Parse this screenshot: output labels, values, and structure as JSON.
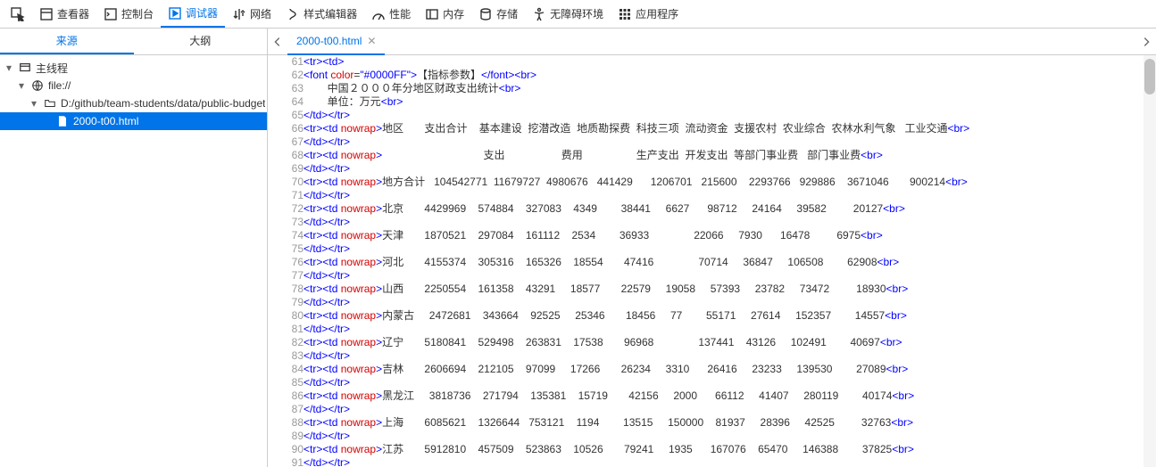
{
  "toolbar": {
    "items": [
      {
        "icon": "picker",
        "label": ""
      },
      {
        "icon": "inspector",
        "label": "查看器"
      },
      {
        "icon": "console",
        "label": "控制台"
      },
      {
        "icon": "debugger",
        "label": "调试器",
        "active": true
      },
      {
        "icon": "network",
        "label": "网络"
      },
      {
        "icon": "style",
        "label": "样式编辑器"
      },
      {
        "icon": "perf",
        "label": "性能"
      },
      {
        "icon": "memory",
        "label": "内存"
      },
      {
        "icon": "storage",
        "label": "存储"
      },
      {
        "icon": "a11y",
        "label": "无障碍环境"
      },
      {
        "icon": "apps",
        "label": "应用程序"
      }
    ]
  },
  "sidebar": {
    "tabs": [
      "来源",
      "大纲"
    ],
    "thread_label": "主线程",
    "file_label": "file://",
    "folder": "D:/github/team-students/data/public-budget",
    "selected_file": "2000-t00.html"
  },
  "editor": {
    "filename": "2000-t00.html"
  },
  "code": {
    "lines": [
      {
        "n": 61,
        "html": "<span class='tag'>&lt;tr&gt;&lt;td&gt;</span>"
      },
      {
        "n": 62,
        "html": "<span class='tag'>&lt;font</span> <span class='attr'>color</span>=<span class='str'>\"#0000FF\"</span><span class='tag'>&gt;</span>【指标参数】<span class='tag'>&lt;/font&gt;&lt;br&gt;</span>"
      },
      {
        "n": 63,
        "html": "        中国２０００年分地区财政支出统计<span class='tag'>&lt;br&gt;</span>"
      },
      {
        "n": 64,
        "html": "        单位：万元<span class='tag'>&lt;br&gt;</span>"
      },
      {
        "n": 65,
        "html": "<span class='tag'>&lt;/td&gt;&lt;/tr&gt;</span>"
      },
      {
        "n": 66,
        "html": "<span class='tag'>&lt;tr&gt;&lt;td</span> <span class='attr'>nowrap</span><span class='tag'>&gt;</span>地区       支出合计    基本建设  挖潜改造  地质勘探费  科技三项  流动资金  支援农村  农业综合  农林水利气象   工业交通<span class='tag'>&lt;br&gt;</span>"
      },
      {
        "n": 67,
        "html": "<span class='tag'>&lt;/td&gt;&lt;/tr&gt;</span>"
      },
      {
        "n": 68,
        "html": "<span class='tag'>&lt;tr&gt;&lt;td</span> <span class='attr'>nowrap</span><span class='tag'>&gt;</span>                                  支出                   费用                  生产支出  开发支出  等部门事业费   部门事业费<span class='tag'>&lt;br&gt;</span>"
      },
      {
        "n": 69,
        "html": "<span class='tag'>&lt;/td&gt;&lt;/tr&gt;</span>"
      },
      {
        "n": 70,
        "html": "<span class='tag'>&lt;tr&gt;&lt;td</span> <span class='attr'>nowrap</span><span class='tag'>&gt;</span>地方合计   104542771  11679727  4980676   441429      1206701   215600    2293766   929886    3671046       900214<span class='tag'>&lt;br&gt;</span>"
      },
      {
        "n": 71,
        "html": "<span class='tag'>&lt;/td&gt;&lt;/tr&gt;</span>"
      },
      {
        "n": 72,
        "html": "<span class='tag'>&lt;tr&gt;&lt;td</span> <span class='attr'>nowrap</span><span class='tag'>&gt;</span>北京       4429969    574884    327083    4349        38441     6627      98712     24164     39582         20127<span class='tag'>&lt;br&gt;</span>"
      },
      {
        "n": 73,
        "html": "<span class='tag'>&lt;/td&gt;&lt;/tr&gt;</span>"
      },
      {
        "n": 74,
        "html": "<span class='tag'>&lt;tr&gt;&lt;td</span> <span class='attr'>nowrap</span><span class='tag'>&gt;</span>天津       1870521    297084    161112    2534        36933               22066     7930      16478         6975<span class='tag'>&lt;br&gt;</span>"
      },
      {
        "n": 75,
        "html": "<span class='tag'>&lt;/td&gt;&lt;/tr&gt;</span>"
      },
      {
        "n": 76,
        "html": "<span class='tag'>&lt;tr&gt;&lt;td</span> <span class='attr'>nowrap</span><span class='tag'>&gt;</span>河北       4155374    305316    165326    18554       47416               70714     36847     106508        62908<span class='tag'>&lt;br&gt;</span>"
      },
      {
        "n": 77,
        "html": "<span class='tag'>&lt;/td&gt;&lt;/tr&gt;</span>"
      },
      {
        "n": 78,
        "html": "<span class='tag'>&lt;tr&gt;&lt;td</span> <span class='attr'>nowrap</span><span class='tag'>&gt;</span>山西       2250554    161358    43291     18577       22579     19058     57393     23782     73472         18930<span class='tag'>&lt;br&gt;</span>"
      },
      {
        "n": 79,
        "html": "<span class='tag'>&lt;/td&gt;&lt;/tr&gt;</span>"
      },
      {
        "n": 80,
        "html": "<span class='tag'>&lt;tr&gt;&lt;td</span> <span class='attr'>nowrap</span><span class='tag'>&gt;</span>内蒙古     2472681    343664    92525     25346       18456     77        55171     27614     152357        14557<span class='tag'>&lt;br&gt;</span>"
      },
      {
        "n": 81,
        "html": "<span class='tag'>&lt;/td&gt;&lt;/tr&gt;</span>"
      },
      {
        "n": 82,
        "html": "<span class='tag'>&lt;tr&gt;&lt;td</span> <span class='attr'>nowrap</span><span class='tag'>&gt;</span>辽宁       5180841    529498    263831    17538       96968               137441    43126     102491        40697<span class='tag'>&lt;br&gt;</span>"
      },
      {
        "n": 83,
        "html": "<span class='tag'>&lt;/td&gt;&lt;/tr&gt;</span>"
      },
      {
        "n": 84,
        "html": "<span class='tag'>&lt;tr&gt;&lt;td</span> <span class='attr'>nowrap</span><span class='tag'>&gt;</span>吉林       2606694    212105    97099     17266       26234     3310      26416     23233     139530        27089<span class='tag'>&lt;br&gt;</span>"
      },
      {
        "n": 85,
        "html": "<span class='tag'>&lt;/td&gt;&lt;/tr&gt;</span>"
      },
      {
        "n": 86,
        "html": "<span class='tag'>&lt;tr&gt;&lt;td</span> <span class='attr'>nowrap</span><span class='tag'>&gt;</span>黑龙江     3818736    271794    135381    15719       42156     2000      66112     41407     280119        40174<span class='tag'>&lt;br&gt;</span>"
      },
      {
        "n": 87,
        "html": "<span class='tag'>&lt;/td&gt;&lt;/tr&gt;</span>"
      },
      {
        "n": 88,
        "html": "<span class='tag'>&lt;tr&gt;&lt;td</span> <span class='attr'>nowrap</span><span class='tag'>&gt;</span>上海       6085621    1326644   753121    1194        13515     150000    81937     28396     42525         32763<span class='tag'>&lt;br&gt;</span>"
      },
      {
        "n": 89,
        "html": "<span class='tag'>&lt;/td&gt;&lt;/tr&gt;</span>"
      },
      {
        "n": 90,
        "html": "<span class='tag'>&lt;tr&gt;&lt;td</span> <span class='attr'>nowrap</span><span class='tag'>&gt;</span>江苏       5912810    457509    523863    10526       79241     1935      167076    65470     146388        37825<span class='tag'>&lt;br&gt;</span>"
      },
      {
        "n": 91,
        "html": "<span class='tag'>&lt;/td&gt;&lt;/tr&gt;</span>"
      }
    ]
  }
}
